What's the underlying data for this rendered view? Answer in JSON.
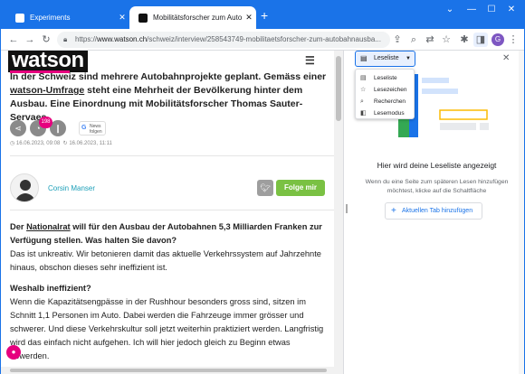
{
  "tabs": [
    {
      "title": "Experiments",
      "favicon_color": "#4285f4"
    },
    {
      "title": "Mobilitätsforscher zum Autobahnausbau",
      "favicon_color": "#111111"
    }
  ],
  "address_bar": {
    "scheme": "https://",
    "host": "www.watson.ch",
    "path": "/schweiz/interview/258543749-mobilitaetsforscher-zum-autobahnausba..."
  },
  "profile_initial": "G",
  "article": {
    "logo": "watson",
    "lead_pre": "In der Schweiz sind mehrere Autobahnprojekte geplant. Gemäss einer ",
    "lead_link": "watson-Umfrage",
    "lead_post": " steht eine Mehrheit der Bevölkerung hinter dem Ausbau. Eine Einordnung mit Mobilitätsforscher Thomas Sauter-Servaes.",
    "comment_count": "198",
    "google_news": "News\nfolgen",
    "date_published": "16.06.2023, 09:08",
    "date_updated": "16.06.2023, 11:11",
    "author": "Corsin Manser",
    "follow_label": "Folge mir",
    "q1_pre": "Der ",
    "q1_link": "Nationalrat",
    "q1_post": " will für den Ausbau der Autobahnen 5,3 Milliarden Franken zur Verfügung stellen. Was halten Sie davon?",
    "a1": "Das ist unkreativ. Wir betonieren damit das aktuelle Verkehrssystem auf Jahrzehnte hinaus, obschon dieses sehr ineffizient ist.",
    "q2": "Weshalb ineffizient?",
    "a2": "Wenn die Kapazitätsengpässe in der Rushhour besonders gross sind, sitzen im Schnitt 1,1 Personen im Auto. Dabei werden die Fahrzeuge immer grösser und schwerer. Und diese Verkehrskultur soll jetzt weiterhin praktiziert werden. Langfristig wird das einfach nicht aufgehen. Ich will hier jedoch gleich zu Beginn etwas abwerden."
  },
  "side_panel": {
    "dropdown_label": "Leseliste",
    "menu_items": [
      "Leseliste",
      "Lesezeichen",
      "Recherchen",
      "Lesemodus"
    ],
    "empty_title": "Hier wird deine Leseliste angezeigt",
    "empty_desc": "Wenn du eine Seite zum späteren Lesen hinzufügen möchtest, klicke auf die Schaltfläche",
    "add_button": "Aktuellen Tab hinzufügen"
  },
  "colors": {
    "chrome_blue": "#1a73e8",
    "watson_pink": "#e6007e",
    "follow_green": "#7ac143",
    "author_link": "#1ea0b9"
  }
}
